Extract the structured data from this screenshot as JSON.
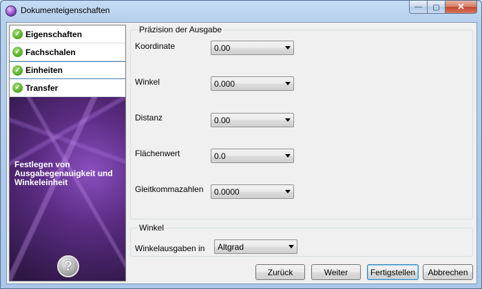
{
  "window": {
    "title": "Dokumenteigenschaften",
    "close_glyph": "✕",
    "max_glyph": "▢",
    "min_glyph": "—"
  },
  "sidebar": {
    "items": [
      {
        "label": "Eigenschaften"
      },
      {
        "label": "Fachschalen"
      },
      {
        "label": "Einheiten"
      },
      {
        "label": "Transfer"
      }
    ],
    "description": "Festlegen von Ausgabegenauigkeit und Winkeleinheit",
    "help_glyph": "?"
  },
  "precision": {
    "title": "Präzision der Ausgabe",
    "koordinate": {
      "label": "Koordinate",
      "value": "0.00"
    },
    "winkel": {
      "label": "Winkel",
      "value": "0.000"
    },
    "distanz": {
      "label": "Distanz",
      "value": "0.00"
    },
    "flaechenwert": {
      "label": "Flächenwert",
      "value": "0.0"
    },
    "gleitkommazahlen": {
      "label": "Gleitkommazahlen",
      "value": "0.0000"
    }
  },
  "angle": {
    "title": "Winkel",
    "output": {
      "label": "Winkelausgaben in",
      "value": "Altgrad"
    }
  },
  "buttons": {
    "back": "Zurück",
    "next": "Weiter",
    "finish": "Fertigstellen",
    "cancel": "Abbrechen"
  }
}
